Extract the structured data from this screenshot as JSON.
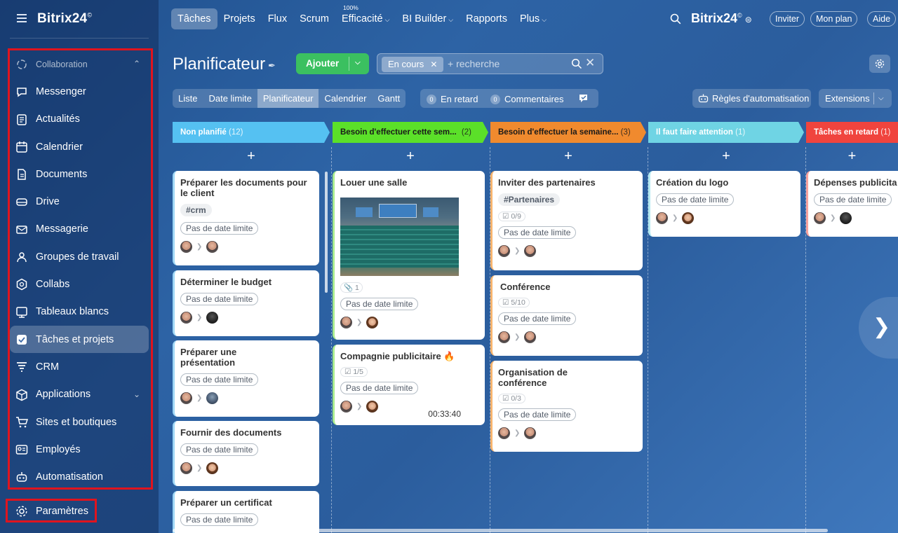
{
  "sidebar": {
    "logo": "Bitrix24",
    "logo_mark": "©",
    "group_label": "Collaboration",
    "items": [
      {
        "label": "Messenger",
        "icon": "chat-icon"
      },
      {
        "label": "Actualités",
        "icon": "news-icon"
      },
      {
        "label": "Calendrier",
        "icon": "calendar-icon"
      },
      {
        "label": "Documents",
        "icon": "document-icon"
      },
      {
        "label": "Drive",
        "icon": "drive-icon"
      },
      {
        "label": "Messagerie",
        "icon": "mail-icon"
      },
      {
        "label": "Groupes de travail",
        "icon": "group-icon"
      },
      {
        "label": "Collabs",
        "icon": "hexagon-icon"
      },
      {
        "label": "Tableaux blancs",
        "icon": "whiteboard-icon"
      },
      {
        "label": "Tâches et projets",
        "icon": "task-check-icon"
      },
      {
        "label": "CRM",
        "icon": "crm-icon"
      },
      {
        "label": "Applications",
        "icon": "package-icon"
      },
      {
        "label": "Sites et boutiques",
        "icon": "cart-icon"
      },
      {
        "label": "Employés",
        "icon": "id-card-icon"
      },
      {
        "label": "Automatisation",
        "icon": "robot-icon"
      }
    ],
    "settings_label": "Paramètres"
  },
  "topnav": {
    "tabs": [
      "Tâches",
      "Projets",
      "Flux",
      "Scrum",
      "Efficacité",
      "BI Builder",
      "Rapports",
      "Plus"
    ],
    "efficiency_pct": "100%",
    "brand": "Bitrix24",
    "brand_mark": "©",
    "invite": "Inviter",
    "plan": "Mon plan",
    "help": "Aide"
  },
  "toolbar": {
    "title": "Planificateur",
    "add_label": "Ajouter",
    "filter_chip": "En cours",
    "search_placeholder": "+ recherche"
  },
  "views": {
    "tabs": [
      "Liste",
      "Date limite",
      "Planificateur",
      "Calendrier",
      "Gantt"
    ],
    "overdue_count": "0",
    "overdue_label": "En retard",
    "comments_count": "0",
    "comments_label": "Commentaires",
    "rules_label": "Règles d'automatisation",
    "extensions_label": "Extensions"
  },
  "columns": [
    {
      "title": "Non planifié",
      "count": "(12)",
      "color": "#55c1f2"
    },
    {
      "title": "Besoin d'effectuer cette sem...",
      "count": "(2)",
      "color": "#5be029"
    },
    {
      "title": "Besoin d'effectuer la semaine...",
      "count": "(3)",
      "color": "#f08a2e"
    },
    {
      "title": "Il faut faire attention",
      "count": "(1)",
      "color": "#6fd4e4"
    },
    {
      "title": "Tâches en retard",
      "count": "(1)",
      "color": "#f0443e"
    }
  ],
  "cards": {
    "c1": {
      "title": "Préparer les documents pour le client",
      "tag": "#crm",
      "deadline": "Pas de date limite"
    },
    "c2": {
      "title": "Déterminer le budget",
      "deadline": "Pas de date limite"
    },
    "c3": {
      "title": "Préparer une présentation",
      "deadline": "Pas de date limite"
    },
    "c4": {
      "title": "Fournir des documents",
      "deadline": "Pas de date limite"
    },
    "c5": {
      "title": "Préparer un certificat",
      "deadline": "Pas de date limite"
    },
    "c6": {
      "title": "Louer une salle",
      "attachments": "1",
      "deadline": "Pas de date limite"
    },
    "c7": {
      "title": "Compagnie publicitaire",
      "checklist": "1/5",
      "deadline": "Pas de date limite",
      "timer": "00:33:40"
    },
    "c8": {
      "title": "Inviter des partenaires",
      "tag": "#Partenaires",
      "checklist": "0/9",
      "deadline": "Pas de date limite"
    },
    "c9": {
      "title": "Conférence",
      "checklist": "5/10",
      "deadline": "Pas de date limite"
    },
    "c10": {
      "title": "Organisation de conférence",
      "checklist": "0/3",
      "deadline": "Pas de date limite"
    },
    "c11": {
      "title": "Création du logo",
      "deadline": "Pas de date limite"
    },
    "c12": {
      "title": "Dépenses publicita",
      "deadline": "Pas de date limite"
    }
  },
  "add_symbol": "+",
  "colors": {
    "add_button": "#3bc060",
    "highlight": "#e0141e"
  }
}
